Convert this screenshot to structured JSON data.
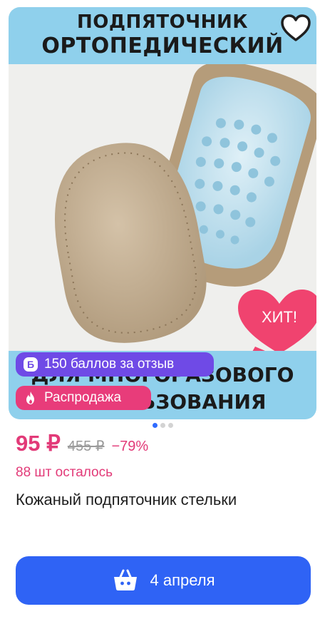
{
  "image": {
    "banner_top_line1": "ПОДПЯТОЧНИК",
    "banner_top_line2": "ОРТОПЕДИЧЕСКИЙ",
    "banner_bottom_line1": "ДЛЯ МНОГОРАЗОВОГО",
    "banner_bottom_line2": "ИСПОЛЬЗОВАНИЯ",
    "hit_label": "ХИТ!"
  },
  "badges": {
    "bonus_icon_letter": "Б",
    "bonus_text": "150 баллов за отзыв",
    "sale_text": "Распродажа"
  },
  "carousel": {
    "total": 3,
    "active": 1
  },
  "price": {
    "current": "95 ₽",
    "old": "455 ₽",
    "discount": "−79%"
  },
  "stock_text": "88 шт осталось",
  "product_title": "Кожаный подпяточник стельки",
  "buy_button": {
    "label": "4 апреля",
    "icon": "basket-icon"
  },
  "colors": {
    "accent_pink": "#e23a78",
    "button_blue": "#2f63f5",
    "bonus_purple": "#6f4ae6",
    "banner_blue": "#8fd0ec"
  }
}
